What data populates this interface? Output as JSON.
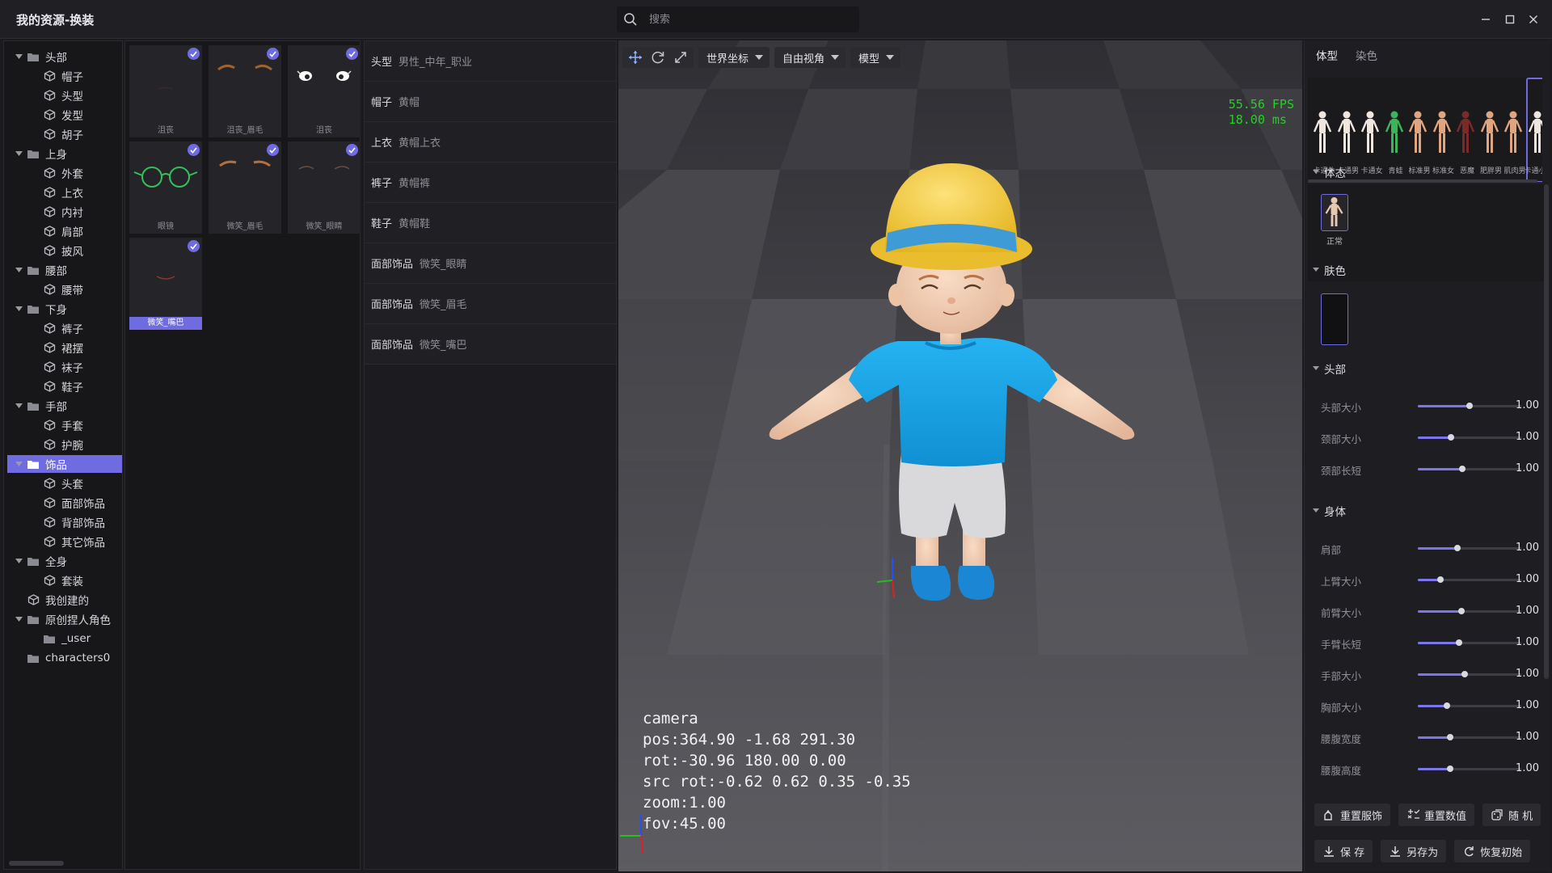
{
  "window": {
    "title": "我的资源-换装"
  },
  "search": {
    "placeholder": "搜索"
  },
  "tree": [
    {
      "label": "头部",
      "level": 0,
      "type": "folder",
      "expanded": true
    },
    {
      "label": "帽子",
      "level": 1,
      "type": "item"
    },
    {
      "label": "头型",
      "level": 1,
      "type": "item"
    },
    {
      "label": "发型",
      "level": 1,
      "type": "item"
    },
    {
      "label": "胡子",
      "level": 1,
      "type": "item"
    },
    {
      "label": "上身",
      "level": 0,
      "type": "folder",
      "expanded": true
    },
    {
      "label": "外套",
      "level": 1,
      "type": "item"
    },
    {
      "label": "上衣",
      "level": 1,
      "type": "item"
    },
    {
      "label": "内衬",
      "level": 1,
      "type": "item"
    },
    {
      "label": "肩部",
      "level": 1,
      "type": "item"
    },
    {
      "label": "披风",
      "level": 1,
      "type": "item"
    },
    {
      "label": "腰部",
      "level": 0,
      "type": "folder",
      "expanded": true
    },
    {
      "label": "腰带",
      "level": 1,
      "type": "item"
    },
    {
      "label": "下身",
      "level": 0,
      "type": "folder",
      "expanded": true
    },
    {
      "label": "裤子",
      "level": 1,
      "type": "item"
    },
    {
      "label": "裙摆",
      "level": 1,
      "type": "item"
    },
    {
      "label": "袜子",
      "level": 1,
      "type": "item"
    },
    {
      "label": "鞋子",
      "level": 1,
      "type": "item"
    },
    {
      "label": "手部",
      "level": 0,
      "type": "folder",
      "expanded": true
    },
    {
      "label": "手套",
      "level": 1,
      "type": "item"
    },
    {
      "label": "护腕",
      "level": 1,
      "type": "item"
    },
    {
      "label": "饰品",
      "level": 0,
      "type": "folder",
      "expanded": true,
      "selected": true
    },
    {
      "label": "头套",
      "level": 1,
      "type": "item"
    },
    {
      "label": "面部饰品",
      "level": 1,
      "type": "item"
    },
    {
      "label": "背部饰品",
      "level": 1,
      "type": "item"
    },
    {
      "label": "其它饰品",
      "level": 1,
      "type": "item"
    },
    {
      "label": "全身",
      "level": 0,
      "type": "folder",
      "expanded": true
    },
    {
      "label": "套装",
      "level": 1,
      "type": "item"
    },
    {
      "label": "我创建的",
      "level": 0,
      "type": "item",
      "noarrow": true
    },
    {
      "label": "原创捏人角色",
      "level": 0,
      "type": "folder",
      "expanded": true
    },
    {
      "label": "_user",
      "level": 1,
      "type": "plainfolder"
    },
    {
      "label": "characters0",
      "level": 0,
      "type": "plainfolder",
      "noarrow": true
    }
  ],
  "thumbnails": [
    {
      "label": "沮丧",
      "art": "mouth-sad",
      "checked": true
    },
    {
      "label": "沮丧_眉毛",
      "art": "brows-sad",
      "checked": true
    },
    {
      "label": "沮丧",
      "art": "eyes-sad",
      "checked": true
    },
    {
      "label": "眼镜",
      "art": "glasses",
      "checked": true
    },
    {
      "label": "微笑_眉毛",
      "art": "brows-smile",
      "checked": true
    },
    {
      "label": "微笑_眼睛",
      "art": "eyes-smile",
      "checked": true
    },
    {
      "label": "微笑_嘴巴",
      "art": "mouth-smile",
      "checked": true,
      "selected": true
    }
  ],
  "equipped": [
    {
      "category": "头型",
      "name": "男性_中年_职业"
    },
    {
      "category": "帽子",
      "name": "黄帽"
    },
    {
      "category": "上衣",
      "name": "黄帽上衣"
    },
    {
      "category": "裤子",
      "name": "黄帽裤"
    },
    {
      "category": "鞋子",
      "name": "黄帽鞋"
    },
    {
      "category": "面部饰品",
      "name": "微笑_眼睛"
    },
    {
      "category": "面部饰品",
      "name": "微笑_眉毛"
    },
    {
      "category": "面部饰品",
      "name": "微笑_嘴巴"
    }
  ],
  "viewport": {
    "toolbar": {
      "tools": [
        "move-icon",
        "rotate-icon",
        "scale-icon"
      ],
      "coord_mode": "世界坐标",
      "view_mode": "自由视角",
      "display_mode": "模型"
    },
    "fps": "55.56 FPS",
    "frame_time": "18.00 ms",
    "camera": {
      "title": "camera",
      "pos": "pos:364.90 -1.68 291.30",
      "rot": "rot:-30.96 180.00 0.00",
      "src_rot": "src rot:-0.62 0.62 0.35 -0.35",
      "zoom": "zoom:1.00",
      "fov": "fov:45.00"
    },
    "colors": {
      "hat": "#f3cd3a",
      "hat_band": "#3f9bd6",
      "shirt": "#18a0e2",
      "shorts": "#d9d9db",
      "shoes": "#1b86d3",
      "skin": "#f1cdb0",
      "axis_x": "#e02020",
      "axis_y": "#20c020",
      "axis_z": "#2050ff"
    }
  },
  "right_panel": {
    "tabs": [
      {
        "label": "体型",
        "active": true
      },
      {
        "label": "染色",
        "active": false
      }
    ],
    "body_types": [
      {
        "caption": "卡通休",
        "variant": "white"
      },
      {
        "caption": "卡通男",
        "variant": "white"
      },
      {
        "caption": "卡通女",
        "variant": "white"
      },
      {
        "caption": "青蛙",
        "variant": "frog"
      },
      {
        "caption": "标准男",
        "variant": "tan"
      },
      {
        "caption": "标准女",
        "variant": "tan"
      },
      {
        "caption": "恶魔",
        "variant": "demon"
      },
      {
        "caption": "肥胖男",
        "variant": "tan"
      },
      {
        "caption": "肌肉男",
        "variant": "tan"
      },
      {
        "caption": "卡通小孩",
        "variant": "white",
        "selected": true
      }
    ],
    "sections": {
      "pose": {
        "title": "体态",
        "item_label": "正常"
      },
      "skin": {
        "title": "肤色"
      },
      "head": {
        "title": "头部",
        "sliders": [
          {
            "label": "头部大小",
            "value": "1.00",
            "pos": 0.5
          },
          {
            "label": "颈部大小",
            "value": "1.00",
            "pos": 0.32
          },
          {
            "label": "颈部长短",
            "value": "1.00",
            "pos": 0.43
          }
        ]
      },
      "body": {
        "title": "身体",
        "sliders": [
          {
            "label": "肩部",
            "value": "1.00",
            "pos": 0.38
          },
          {
            "label": "上臂大小",
            "value": "1.00",
            "pos": 0.22
          },
          {
            "label": "前臂大小",
            "value": "1.00",
            "pos": 0.42
          },
          {
            "label": "手臂长短",
            "value": "1.00",
            "pos": 0.4
          },
          {
            "label": "手部大小",
            "value": "1.00",
            "pos": 0.45
          },
          {
            "label": "胸部大小",
            "value": "1.00",
            "pos": 0.28
          },
          {
            "label": "腰腹宽度",
            "value": "1.00",
            "pos": 0.31
          },
          {
            "label": "腰腹高度",
            "value": "1.00",
            "pos": 0.31
          }
        ]
      }
    },
    "buttons_row1": [
      {
        "label": "重置服饰",
        "icon": "reset-clothes-icon"
      },
      {
        "label": "重置数值",
        "icon": "reset-values-icon"
      },
      {
        "label": "随 机",
        "icon": "dice-icon"
      }
    ],
    "buttons_row2": [
      {
        "label": "保 存",
        "icon": "save-icon"
      },
      {
        "label": "另存为",
        "icon": "save-as-icon"
      },
      {
        "label": "恢复初始",
        "icon": "restore-icon"
      }
    ],
    "accent": "#6f6be0"
  }
}
